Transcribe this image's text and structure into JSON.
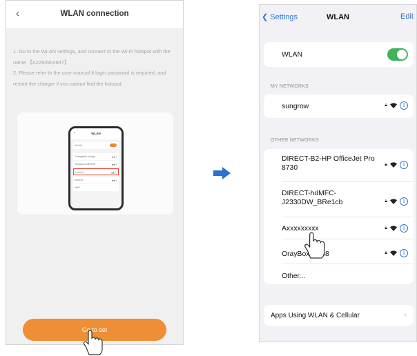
{
  "left_screen": {
    "title": "WLAN connection",
    "back_glyph": "‹",
    "instructions": [
      "1. Go to the WLAN settings, and connect to the Wi-Fi hotspot with the name 【A2292804847】.",
      "2. Please refer to the user manual if login password is required, and restart the charger if you cannot find the hotspot."
    ],
    "illustration": {
      "title": "WLAN",
      "rows": [
        "WLAN",
        "Chargelink-image",
        "Sungrow-AB0305",
        "••••••••••",
        "sun001",
        "WiFi"
      ]
    },
    "go_next_button": "Go to set",
    "accent_color": "#ee8e35"
  },
  "arrow_color": "#2e6fcf",
  "right_screen": {
    "nav": {
      "back_label": "Settings",
      "title": "WLAN",
      "edit_label": "Edit"
    },
    "wlan_toggle": {
      "label": "WLAN",
      "on": true,
      "color": "#41b35a"
    },
    "my_networks_header": "MY NETWORKS",
    "my_networks": [
      {
        "name": "sungrow",
        "locked": true
      }
    ],
    "other_networks_header": "OTHER NETWORKS",
    "other_networks": [
      {
        "name": "DIRECT-B2-HP OfficeJet Pro 8730",
        "locked": true
      },
      {
        "name": "DIRECT-hdMFC-J2330DW_BRe1cb",
        "locked": true
      },
      {
        "name": "Axxxxxxxxx",
        "locked": true
      },
      {
        "name": "OrayBox-C868",
        "locked": true
      }
    ],
    "other_label": "Other...",
    "apps_using_label": "Apps Using WLAN & Cellular",
    "link_color": "#2e72d6"
  }
}
